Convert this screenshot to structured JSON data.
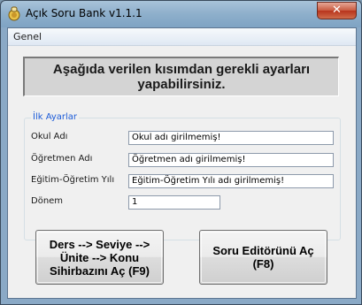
{
  "window": {
    "title": "Açık Soru Bank v1.1.1",
    "close_glyph": "✕"
  },
  "menu": {
    "items": [
      "Genel"
    ]
  },
  "banner": {
    "text": "Aşağıda verilen kısımdan gerekli ayarları\nyapabilirsiniz."
  },
  "settings": {
    "group_title": "İlk Ayarlar",
    "fields": [
      {
        "label": "Okul Adı",
        "value": "Okul adı girilmemiş!"
      },
      {
        "label": "Öğretmen Adı",
        "value": "Öğretmen adı girilmemiş!"
      },
      {
        "label": "Eğitim-Öğretim Yılı",
        "value": "Eğitim-Öğretim Yılı adı girilmemiş!"
      },
      {
        "label": "Dönem",
        "value": "1"
      }
    ]
  },
  "buttons": {
    "wizard": "Ders --> Seviye -->\nÜnite --> Konu\nSihirbazını Aç (F9)",
    "editor": "Soru Editörünü Aç\n(F8)"
  }
}
